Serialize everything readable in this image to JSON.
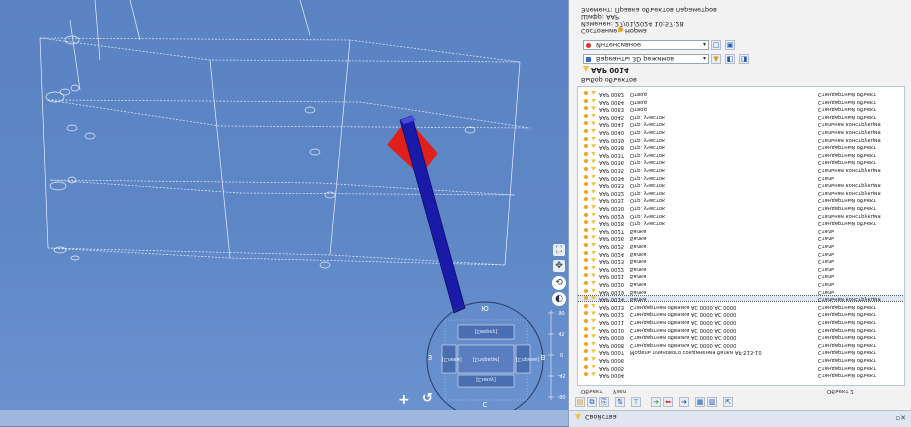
{
  "viewport": {
    "nav_cube": {
      "top": "[Cверху]",
      "center": "[Спереди]",
      "left": "[Слева]",
      "right": "[Справа]",
      "bottom": "[Снизу]",
      "north": "Ю",
      "south": "С",
      "west": "З",
      "east": "В"
    },
    "rotation_scale": [
      "90",
      "45",
      "0",
      "-45",
      "-90"
    ],
    "colors": {
      "background": "#5e86c4",
      "column": "#1a1aa8",
      "plane": "#e0201a",
      "wire": "#e8eef8"
    }
  },
  "panel": {
    "header": {
      "line1": "Элемент: Правка объектов параметров",
      "line2": "Шифр: ААР",
      "line3": "Изменен: 27/01/2024 10:57:28",
      "status_label": "Состояние:",
      "status_value": "Норма"
    },
    "combo1": {
      "value": "Интенсивное"
    },
    "combo2": {
      "value": "Варианты 3D режимов"
    },
    "current_item": "ААР 0014",
    "list_title": "Выбор объектов",
    "columns": [
      "Объект",
      "Узел",
      "Объект 2"
    ],
    "rows": [
      {
        "code": "ААР 0062",
        "name": "Отвод",
        "type": "Стандартный объект"
      },
      {
        "code": "ААР 0064",
        "name": "Отвод",
        "type": "Стандартный объект"
      },
      {
        "code": "ААР 0063",
        "name": "Отвод",
        "type": "Стандартный объект"
      },
      {
        "code": "ААР 0045",
        "name": "Отр. участок",
        "type": "Стандартный объект"
      },
      {
        "code": "ААР 0041",
        "name": "Отр. участок",
        "type": "Стальная конструкция"
      },
      {
        "code": "ААР 0040",
        "name": "Отр. участок",
        "type": "Стальная конструкция"
      },
      {
        "code": "ААР 0039",
        "name": "Отр. участок",
        "type": "Стальная конструкция"
      },
      {
        "code": "ААР 0038",
        "name": "Отр. участок",
        "type": "Стандартный объект"
      },
      {
        "code": "ААР 0037",
        "name": "Отр. участок",
        "type": "Стандартный объект"
      },
      {
        "code": "ААР 0036",
        "name": "Отр. участок",
        "type": "Стандартный объект"
      },
      {
        "code": "ААР 0035",
        "name": "Отр. участок",
        "type": "Стальная конструкция"
      },
      {
        "code": "ААР 0034",
        "name": "Отр. участок",
        "type": "Сталь"
      },
      {
        "code": "ААР 0033",
        "name": "Отр. участок",
        "type": "Стальная конструкция"
      },
      {
        "code": "ААР 0032",
        "name": "Отр. участок",
        "type": "Стальная конструкция"
      },
      {
        "code": "ААР 0031",
        "name": "Отр. участок",
        "type": "Стандартный объект"
      },
      {
        "code": "ААР 0030",
        "name": "Отр. участок",
        "type": "Стандартный объект"
      },
      {
        "code": "ААР 0029",
        "name": "Отр. участок",
        "type": "Стальная конструкция"
      },
      {
        "code": "ААР 0028",
        "name": "Отр. участок",
        "type": "Стандартный объект"
      },
      {
        "code": "ААР 0027",
        "name": "Балка",
        "type": "Сталь"
      },
      {
        "code": "ААР 0026",
        "name": "Балка",
        "type": "Сталь"
      },
      {
        "code": "ААР 0025",
        "name": "Балка",
        "type": "Сталь"
      },
      {
        "code": "ААР 0024",
        "name": "Балка",
        "type": "Сталь"
      },
      {
        "code": "ААР 0023",
        "name": "Балка",
        "type": "Сталь"
      },
      {
        "code": "ААР 0022",
        "name": "Балка",
        "type": "Сталь"
      },
      {
        "code": "ААР 0021",
        "name": "Балка",
        "type": "Сталь"
      },
      {
        "code": "ААР 0020",
        "name": "Балка",
        "type": "Сталь"
      },
      {
        "code": "ААР 0019",
        "name": "Балка",
        "type": "Сталь"
      },
      {
        "code": "ААР 0014",
        "name": "Балка",
        "type": "Стальная конструкция",
        "selected": true
      },
      {
        "code": "ААР 0013",
        "name": "Стандартная обвязка AC 0000 AC 0000",
        "type": "Стандартный объект"
      },
      {
        "code": "ААР 0012",
        "name": "Стандартная обвязка AC 0000 AC 0000",
        "type": "Стандартный объект"
      },
      {
        "code": "ААР 0011",
        "name": "Стандартная обвязка AC 0000 AC 0000",
        "type": "Стандартный объект"
      },
      {
        "code": "ААР 0010",
        "name": "Стандартная обвязка AC 0000 AC 0000",
        "type": "Стандартный объект"
      },
      {
        "code": "ААР 0009",
        "name": "Стандартная обвязка AC 0000 AC 0000",
        "type": "Стандартный объект"
      },
      {
        "code": "ААР 0008",
        "name": "Стандартная обвязка AC 0000 AC 0000",
        "type": "Стандартный объект"
      },
      {
        "code": "ААР 0007",
        "name": "Модель планового соединения балки AP-513-10",
        "type": "Стандартный объект"
      },
      {
        "code": "ААР 0006",
        "name": "",
        "type": "Стандартный объект"
      },
      {
        "code": "ААР 0005",
        "name": "",
        "type": "Стандартный объект"
      },
      {
        "code": "ААР 0004",
        "name": "",
        "type": "Стандартный объект"
      }
    ],
    "footer_label": "Свойства"
  }
}
